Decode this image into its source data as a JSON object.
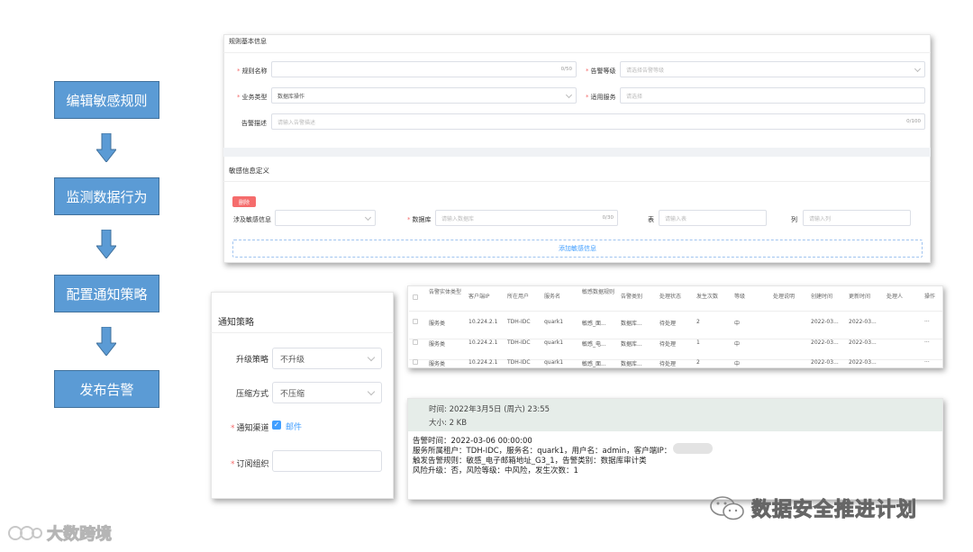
{
  "flow": {
    "steps": [
      "编辑敏感规则",
      "监测数据行为",
      "配置通知策略",
      "发布告警"
    ],
    "colors": {
      "box": "#5b9bd5",
      "border": "#41719c"
    }
  },
  "rule_form": {
    "section1_title": "规则基本信息",
    "rule_name_label": "规则名称",
    "rule_name_count": "0/50",
    "alert_level_label": "告警等级",
    "alert_level_placeholder": "请选择告警等级",
    "biz_type_label": "业务类型",
    "biz_type_value": "数据库操作",
    "service_label": "适用服务",
    "service_placeholder": "请选择",
    "desc_label": "告警描述",
    "desc_placeholder": "请输入告警描述",
    "desc_count": "0/100",
    "section2_title": "敏感信息定义",
    "delete_button": "删除",
    "sensitive_label": "涉及敏感信息",
    "db_label": "数据库",
    "db_placeholder": "请输入数据库",
    "db_count": "0/30",
    "table_label": "表",
    "table_placeholder": "请输入表",
    "col_label": "列",
    "col_placeholder": "请输入列",
    "add_button": "添加敏感信息"
  },
  "notify": {
    "title": "通知策略",
    "upgrade_label": "升级策略",
    "upgrade_value": "不升级",
    "compress_label": "压缩方式",
    "compress_value": "不压缩",
    "channel_label": "通知渠道",
    "channel_option": "邮件",
    "org_label": "订阅组织"
  },
  "alert_table": {
    "headers": [
      "告警实体类型",
      "客户端IP",
      "所在用户",
      "服务名",
      "敏感数据规则",
      "告警类别",
      "处理状态",
      "发生次数",
      "等级",
      "处理说明",
      "创建时间",
      "更新时间",
      "处理人",
      "操作"
    ],
    "rows": [
      [
        "服务类",
        "10.224.2.1",
        "TDH-IDC",
        "quark1",
        "敏感_面...",
        "数据库...",
        "待处理",
        "2",
        "中",
        "",
        "2022-03...",
        "2022-03...",
        "",
        "···"
      ],
      [
        "服务类",
        "10.224.2.1",
        "TDH-IDC",
        "quark1",
        "敏感_电...",
        "数据库...",
        "待处理",
        "1",
        "中",
        "",
        "2022-03...",
        "2022-03...",
        "",
        "···"
      ],
      [
        "服务类",
        "10.224.2.1",
        "TDH-IDC",
        "quark1",
        "敏感_面...",
        "数据库...",
        "待处理",
        "2",
        "中",
        "",
        "2022-03...",
        "2022-03...",
        "",
        "···"
      ]
    ]
  },
  "mail": {
    "time": "时间: 2022年3月5日 (周六) 23:55",
    "size": "大小: 2 KB",
    "lines": [
      "告警时间：2022-03-06 00:00:00",
      "服务所属租户：TDH-IDC，服务名：quark1，用户名：admin，客户端IP：",
      "触发告警规则：敏感_电子邮箱地址_G3_1，告警类别：数据库审计类",
      "风险升级：否，风险等级：中风险，发生次数：1"
    ]
  },
  "watermarks": {
    "left": "大数跨境",
    "right": "数据安全推进计划"
  }
}
